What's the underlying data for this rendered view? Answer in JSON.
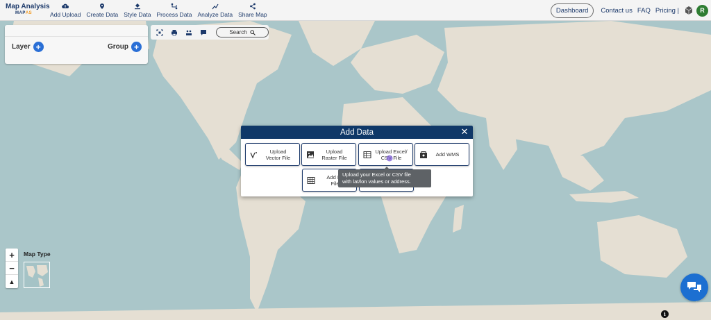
{
  "app": {
    "title": "Map Analysis",
    "subtitle_prefix": "MAP",
    "subtitle_suffix": "AS"
  },
  "nav": {
    "items": [
      {
        "label": "Add Upload",
        "icon": "cloud-upload-icon"
      },
      {
        "label": "Create Data",
        "icon": "map-pin-icon"
      },
      {
        "label": "Style Data",
        "icon": "paint-bucket-icon"
      },
      {
        "label": "Process Data",
        "icon": "process-icon"
      },
      {
        "label": "Analyze Data",
        "icon": "analyze-icon"
      },
      {
        "label": "Share Map",
        "icon": "share-icon"
      }
    ],
    "dashboard": "Dashboard",
    "contact": "Contact us",
    "faq": "FAQ",
    "pricing": "Pricing |",
    "avatar_initial": "R"
  },
  "layer_panel": {
    "layer_label": "Layer",
    "group_label": "Group",
    "plus": "+"
  },
  "map_tools": {
    "search_label": "Search"
  },
  "map_controls": {
    "zoom_in": "+",
    "zoom_out": "−",
    "north": "▲",
    "map_type_label": "Map Type"
  },
  "modal": {
    "title": "Add Data",
    "close": "✕",
    "options": [
      {
        "line1": "Upload",
        "line2": "Vector File",
        "icon": "vector-icon"
      },
      {
        "line1": "Upload",
        "line2": "Raster File",
        "icon": "raster-image-icon"
      },
      {
        "line1": "Upload Excel/",
        "line2": "CSV File",
        "icon": "spreadsheet-icon"
      },
      {
        "line1": "Add WMS",
        "line2": "",
        "icon": "wms-icon"
      },
      {
        "line1": "Add Ex",
        "line2": "File",
        "icon": "table-icon"
      },
      {
        "line1": "",
        "line2": "",
        "icon": ""
      }
    ],
    "tooltip_line1": "Upload your Excel or CSV file",
    "tooltip_line2": "with lat/lon values or address."
  },
  "colors": {
    "ocean": "#aac6c9",
    "land": "#e5dfd3",
    "brand_navy": "#0f3868",
    "accent_blue": "#2a6fd6",
    "logo_orange": "#f29a21",
    "avatar_green": "#2e7d32"
  }
}
